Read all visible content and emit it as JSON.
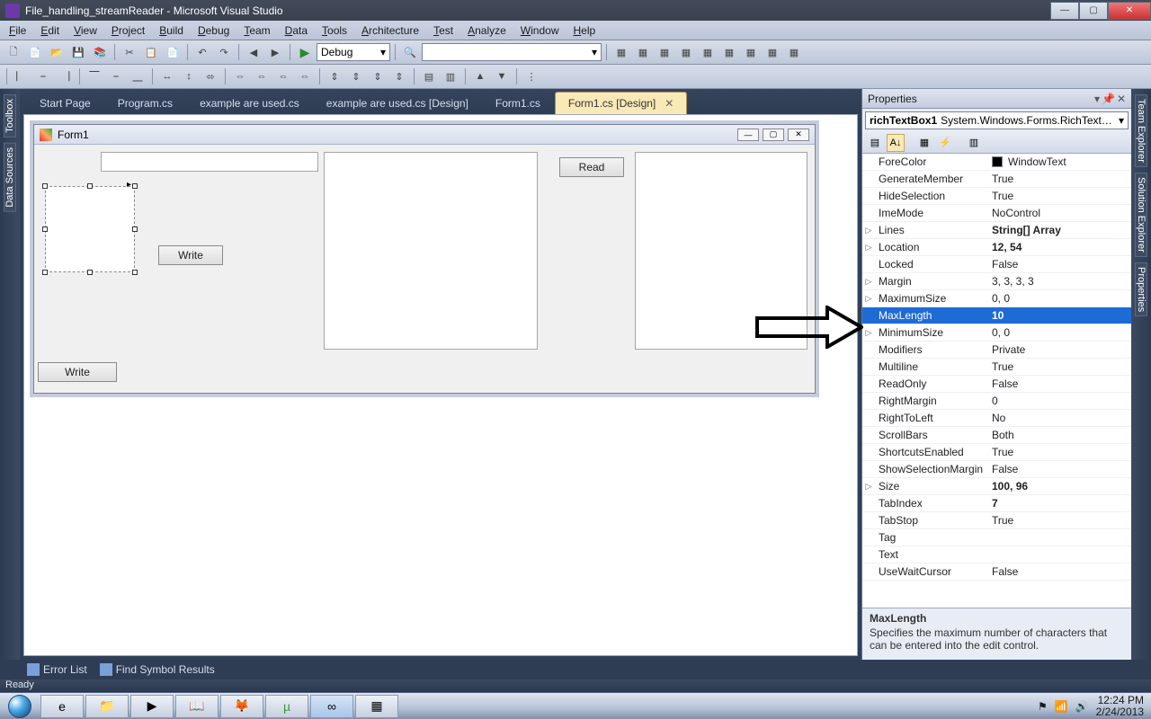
{
  "title": "File_handling_streamReader - Microsoft Visual Studio",
  "menus": [
    "File",
    "Edit",
    "View",
    "Project",
    "Build",
    "Debug",
    "Team",
    "Data",
    "Tools",
    "Architecture",
    "Test",
    "Analyze",
    "Window",
    "Help"
  ],
  "config": "Debug",
  "leftTabs": [
    "Toolbox",
    "Data Sources"
  ],
  "rightTabs": [
    "Team Explorer",
    "Solution Explorer",
    "Properties"
  ],
  "docTabs": [
    {
      "label": "Start Page"
    },
    {
      "label": "Program.cs"
    },
    {
      "label": "example are used.cs"
    },
    {
      "label": "example are used.cs [Design]"
    },
    {
      "label": "Form1.cs"
    },
    {
      "label": "Form1.cs [Design]",
      "active": true
    }
  ],
  "form": {
    "title": "Form1",
    "buttons": {
      "write": "Write",
      "read": "Read",
      "write2": "Write"
    }
  },
  "props": {
    "title": "Properties",
    "object": {
      "name": "richTextBox1",
      "type": "System.Windows.Forms.RichTextBox"
    },
    "rows": [
      {
        "n": "ForeColor",
        "v": "WindowText",
        "swatch": true
      },
      {
        "n": "GenerateMember",
        "v": "True"
      },
      {
        "n": "HideSelection",
        "v": "True"
      },
      {
        "n": "ImeMode",
        "v": "NoControl"
      },
      {
        "n": "Lines",
        "v": "String[] Array",
        "exp": true,
        "bold": true
      },
      {
        "n": "Location",
        "v": "12, 54",
        "exp": true,
        "bold": true
      },
      {
        "n": "Locked",
        "v": "False"
      },
      {
        "n": "Margin",
        "v": "3, 3, 3, 3",
        "exp": true
      },
      {
        "n": "MaximumSize",
        "v": "0, 0",
        "exp": true
      },
      {
        "n": "MaxLength",
        "v": "10",
        "selected": true,
        "bold": true
      },
      {
        "n": "MinimumSize",
        "v": "0, 0",
        "exp": true
      },
      {
        "n": "Modifiers",
        "v": "Private"
      },
      {
        "n": "Multiline",
        "v": "True"
      },
      {
        "n": "ReadOnly",
        "v": "False"
      },
      {
        "n": "RightMargin",
        "v": "0"
      },
      {
        "n": "RightToLeft",
        "v": "No"
      },
      {
        "n": "ScrollBars",
        "v": "Both"
      },
      {
        "n": "ShortcutsEnabled",
        "v": "True"
      },
      {
        "n": "ShowSelectionMargin",
        "v": "False"
      },
      {
        "n": "Size",
        "v": "100, 96",
        "exp": true,
        "bold": true
      },
      {
        "n": "TabIndex",
        "v": "7",
        "bold": true
      },
      {
        "n": "TabStop",
        "v": "True"
      },
      {
        "n": "Tag",
        "v": ""
      },
      {
        "n": "Text",
        "v": ""
      },
      {
        "n": "UseWaitCursor",
        "v": "False"
      }
    ],
    "desc": {
      "title": "MaxLength",
      "body": "Specifies the maximum number of characters that can be entered into the edit control."
    }
  },
  "bottomTabs": [
    "Error List",
    "Find Symbol Results"
  ],
  "status": "Ready",
  "tray": {
    "time": "12:24 PM",
    "date": "2/24/2013"
  }
}
